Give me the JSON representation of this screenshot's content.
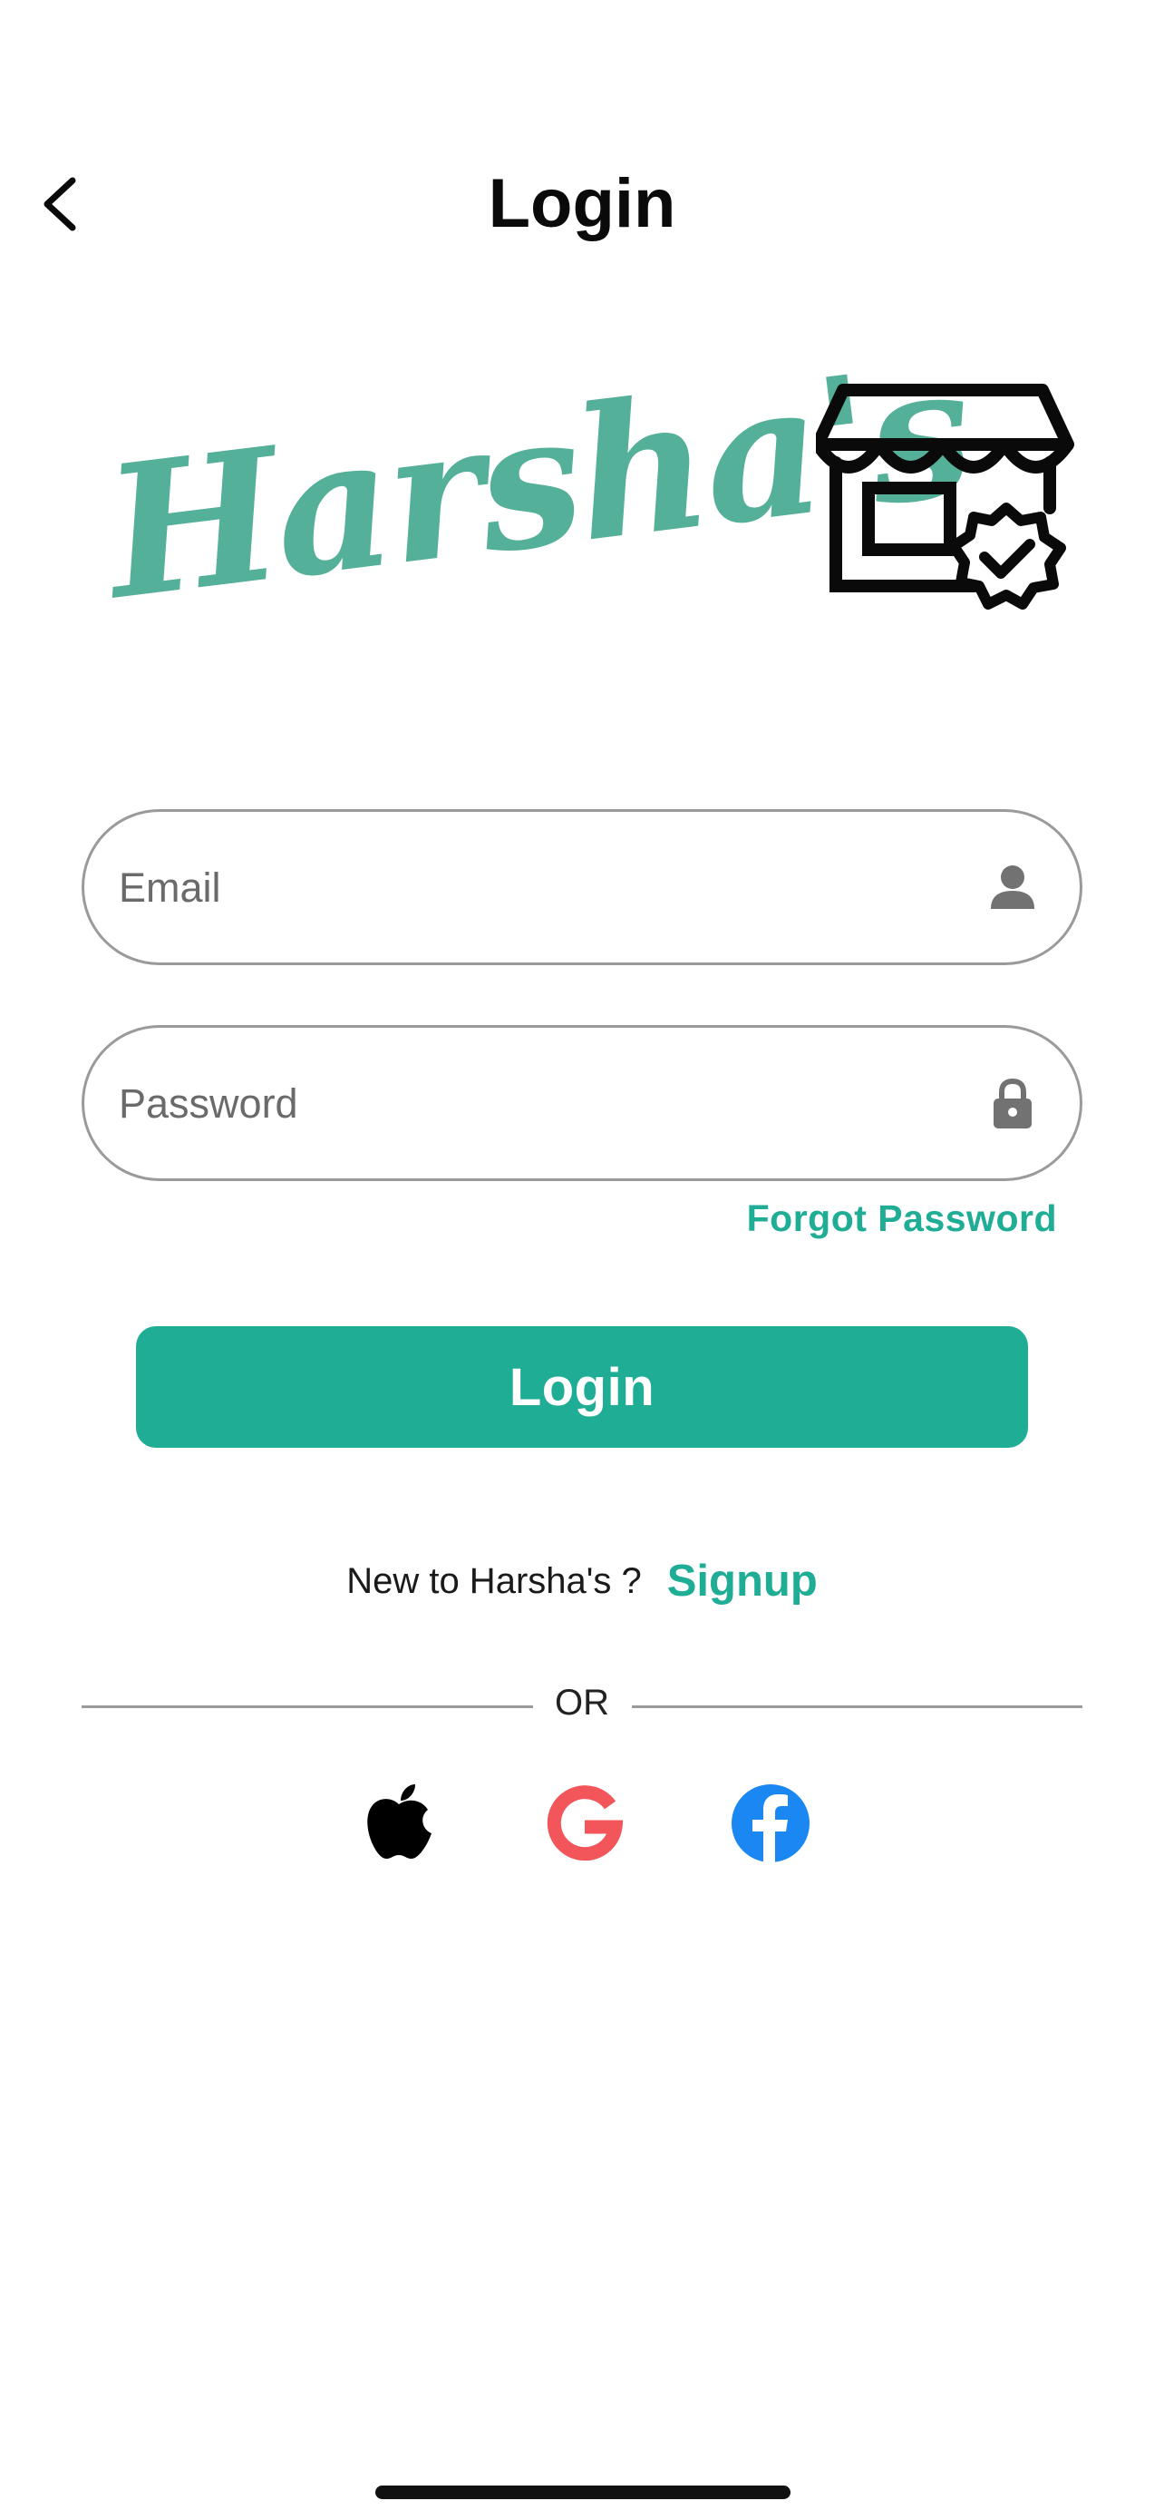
{
  "header": {
    "title": "Login",
    "back_icon": "chevron-left-icon"
  },
  "logo": {
    "text": "Harsha's",
    "text_color": "#55b09a",
    "store_icon": "storefront-verified-icon"
  },
  "form": {
    "email": {
      "placeholder": "Email",
      "value": "",
      "icon": "person-icon"
    },
    "password": {
      "placeholder": "Password",
      "value": "",
      "icon": "lock-icon"
    },
    "forgot_label": "Forgot Password",
    "login_label": "Login"
  },
  "signup": {
    "prompt": "New to Harsha's ?",
    "link_label": "Signup"
  },
  "divider": {
    "label": "OR"
  },
  "social": [
    {
      "icon": "apple-icon"
    },
    {
      "icon": "google-icon"
    },
    {
      "icon": "facebook-icon"
    }
  ],
  "colors": {
    "accent": "#1fad96",
    "field_border": "#9a9a9a",
    "google": "#f2555a",
    "facebook": "#1b87f3"
  }
}
